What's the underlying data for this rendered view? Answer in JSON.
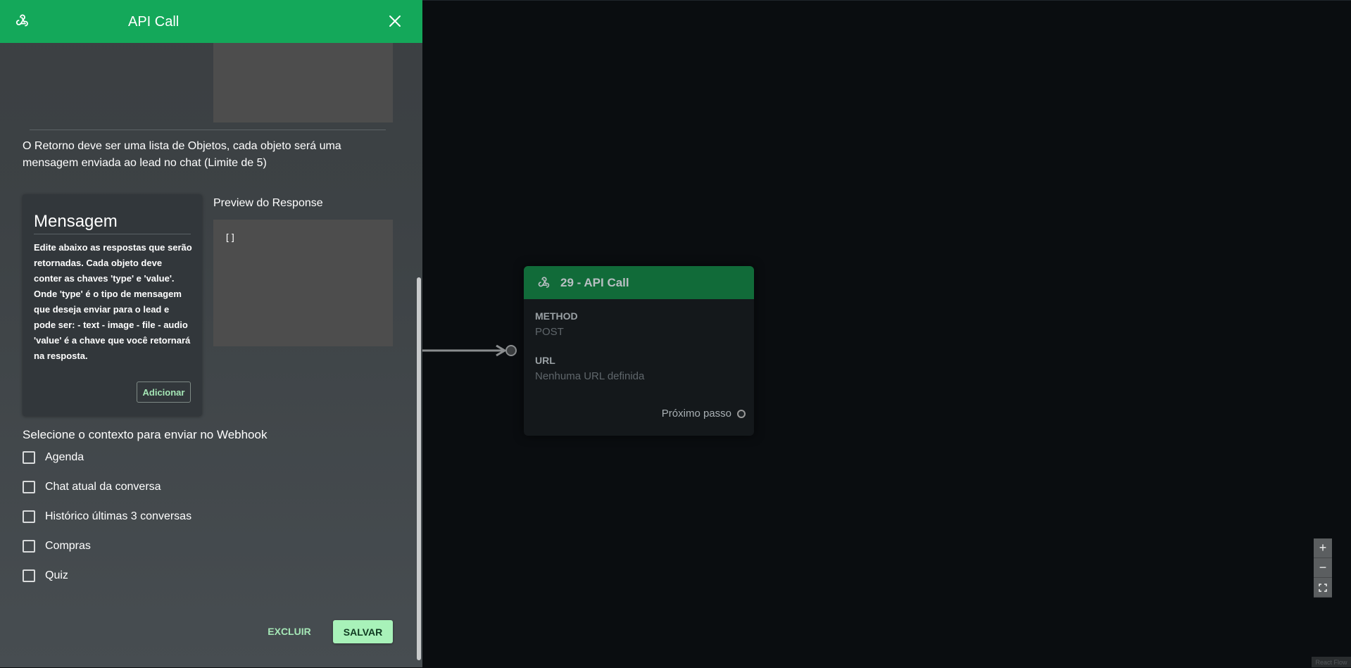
{
  "sidebar": {
    "title": "API Call",
    "header_icon": "webhook-icon",
    "close_icon": "close-icon",
    "info_text": "O Retorno deve ser uma lista de Objetos, cada objeto será uma mensagem enviada ao lead no chat (Limite de 5)",
    "message_card": {
      "title": "Mensagem",
      "description": "Edite abaixo as respostas que serão retornadas. Cada objeto deve conter as chaves 'type' e 'value'. Onde 'type' é o tipo de mensagem que deseja enviar para o lead e pode ser: - text - image - file - audio 'value' é a chave que você retornará na resposta.",
      "add_button": "Adicionar"
    },
    "preview": {
      "label": "Preview do Response",
      "code": "[]"
    },
    "context": {
      "label": "Selecione o contexto para enviar no Webhook",
      "options": [
        {
          "label": "Agenda",
          "checked": false
        },
        {
          "label": "Chat atual da conversa",
          "checked": false
        },
        {
          "label": "Histórico últimas 3 conversas",
          "checked": false
        },
        {
          "label": "Compras",
          "checked": false
        },
        {
          "label": "Quiz",
          "checked": false
        }
      ]
    },
    "delete_button": "EXCLUIR",
    "save_button": "SALVAR"
  },
  "node": {
    "title": "29 - API Call",
    "icon": "webhook-icon",
    "method_label": "METHOD",
    "method_value": "POST",
    "url_label": "URL",
    "url_value": "Nenhuma URL definida",
    "next_step": "Próximo passo"
  },
  "controls": {
    "zoom_in": "+",
    "zoom_out": "−",
    "fit_icon": "fit-view-icon"
  },
  "attribution": "React Flow",
  "colors": {
    "header_green": "#14a85a",
    "node_header": "#116b39",
    "accent_light": "#a8f2b9",
    "canvas_bg": "#0a0d10"
  }
}
